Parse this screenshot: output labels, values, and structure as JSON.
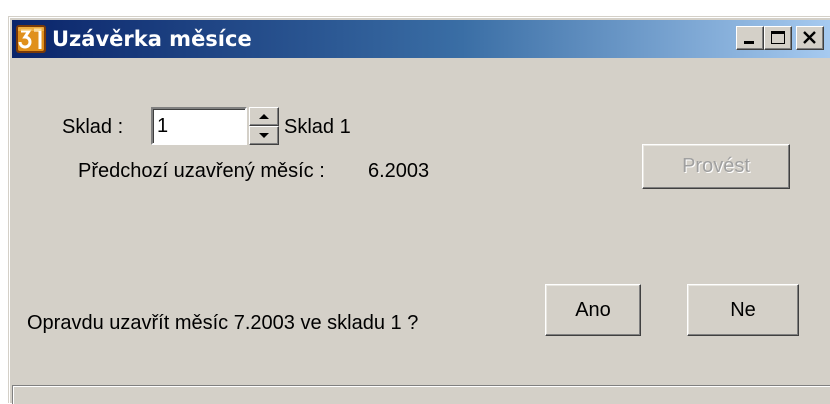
{
  "window": {
    "title": "Uzávěrka měsíce",
    "app_icon": "app-logo-icon",
    "controls": [
      "minimize-icon",
      "maximize-icon",
      "close-icon"
    ]
  },
  "form": {
    "sklad_label": "Sklad :",
    "sklad_value": "1",
    "sklad_name": "Sklad 1",
    "prev_month_label": "Předchozí uzavřený měsíc :",
    "prev_month_value": "6.2003",
    "provest_label": "Provést"
  },
  "confirm": {
    "question": "Opravdu uzavřít měsíc 7.2003 ve skladu 1 ?",
    "yes_label": "Ano",
    "no_label": "Ne"
  },
  "colors": {
    "title_gradient_start": "#0a246a",
    "title_gradient_end": "#a6caf0",
    "face": "#d4d0c8",
    "disabled_text": "#a0a0a0"
  }
}
